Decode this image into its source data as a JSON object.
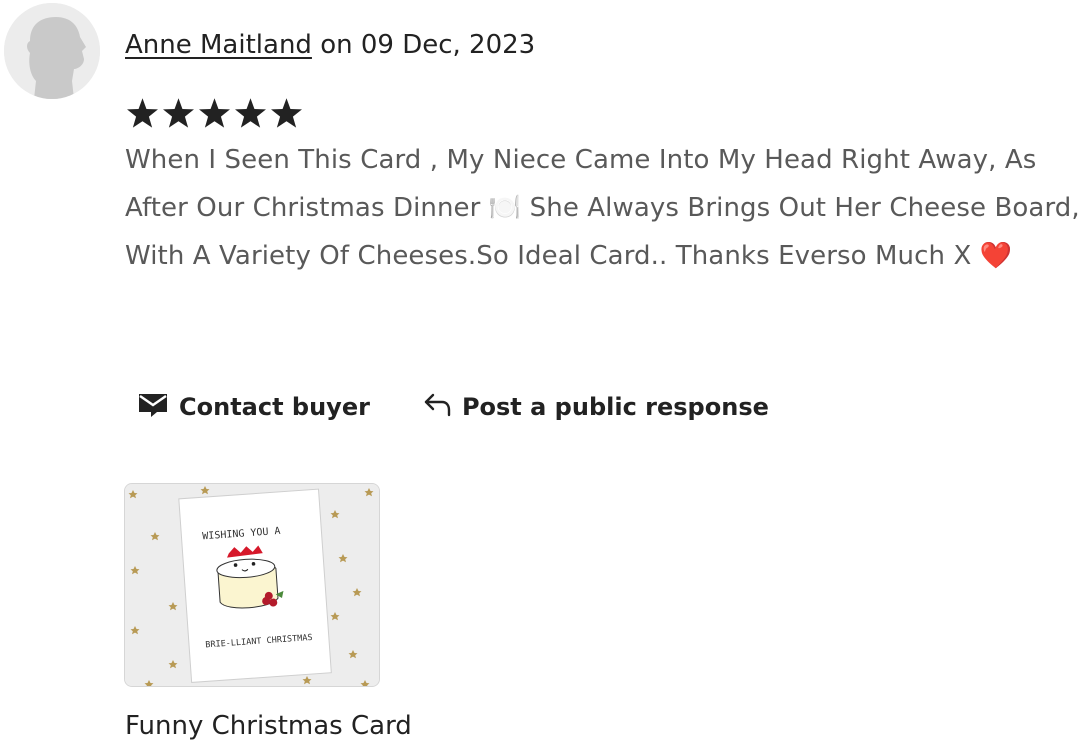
{
  "review": {
    "author": "Anne Maitland",
    "date_text": " on 09 Dec, 2023",
    "rating": 5,
    "rating_max": 5,
    "text": "When I Seen This Card , My Niece Came Into My Head Right Away, As After Our Christmas Dinner 🍽️ She Always Brings Out Her Cheese Board, With A Variety Of Cheeses.So Ideal Card.. Thanks Everso Much X ❤️"
  },
  "actions": {
    "contact_label": "Contact buyer",
    "response_label": "Post a public response"
  },
  "item": {
    "title": "Funny Christmas Card",
    "card_text_top": "WISHING YOU A",
    "card_text_bottom": "BRIE-LLIANT CHRISTMAS"
  },
  "colors": {
    "text_primary": "#222222",
    "text_secondary": "#595959",
    "star": "#222222",
    "gold_star": "#b89a55",
    "heart": "#d6182a"
  }
}
